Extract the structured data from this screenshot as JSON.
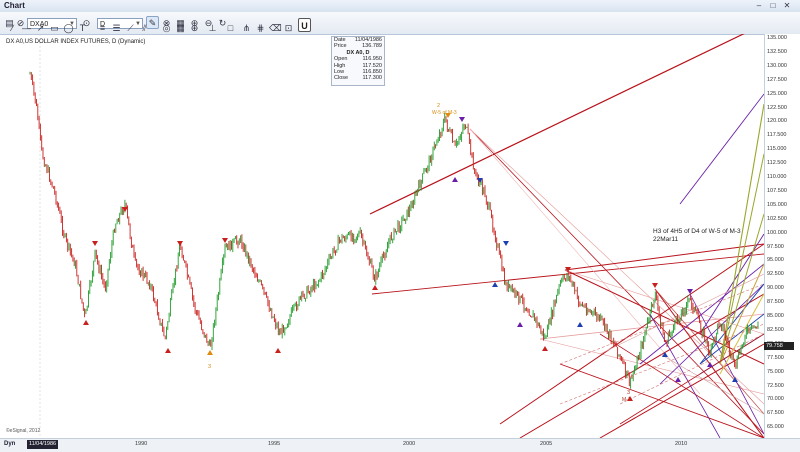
{
  "window": {
    "title": "Chart"
  },
  "toolbar": {
    "symbol": "DXA0",
    "interval": "D",
    "u_button": "U"
  },
  "chart": {
    "symbol_label": "DX A0,US DOLLAR INDEX FUTURES, D (Dynamic)",
    "copyright": "©eSignal, 2012",
    "annotation_line1": "H3 of 4H5 of D4 of W-5 of M-3",
    "annotation_line2": "22Mar11",
    "last_price": "79.758",
    "peak_label": "W-5 of M-3",
    "peak_marker": "2",
    "low1_marker": "3",
    "low2_marker": "3",
    "low2_label": "M-1",
    "colors": {
      "up_bar": "#1f9a2a",
      "down_bar": "#c8201c",
      "resistance": "#b8121b",
      "fan_purple": "#6a1fa8",
      "fan_blue": "#1d3fb0",
      "fan_olive": "#9aa62a"
    }
  },
  "databox": {
    "date_label": "Date",
    "date_value": "11/04/1986",
    "price_label": "Price",
    "price_value": "136.789",
    "header": "DX A0, D",
    "open_label": "Open",
    "open_value": "116.950",
    "high_label": "High",
    "high_value": "117.520",
    "low_label": "Low",
    "low_value": "116.850",
    "close_label": "Close",
    "close_value": "117.300"
  },
  "y_axis": [
    "135.000",
    "132.500",
    "130.000",
    "127.500",
    "125.000",
    "122.500",
    "120.000",
    "117.500",
    "115.000",
    "112.500",
    "110.000",
    "107.500",
    "105.000",
    "102.500",
    "100.000",
    "97.500",
    "95.000",
    "92.500",
    "90.000",
    "87.500",
    "85.000",
    "82.500",
    "80.000",
    "77.500",
    "75.000",
    "72.500",
    "70.000",
    "67.500",
    "65.000"
  ],
  "x_axis": {
    "dyn_label": "Dyn",
    "current_date": "11/04/1986",
    "ticks": [
      "1990",
      "1995",
      "2000",
      "2005",
      "2010"
    ]
  }
}
